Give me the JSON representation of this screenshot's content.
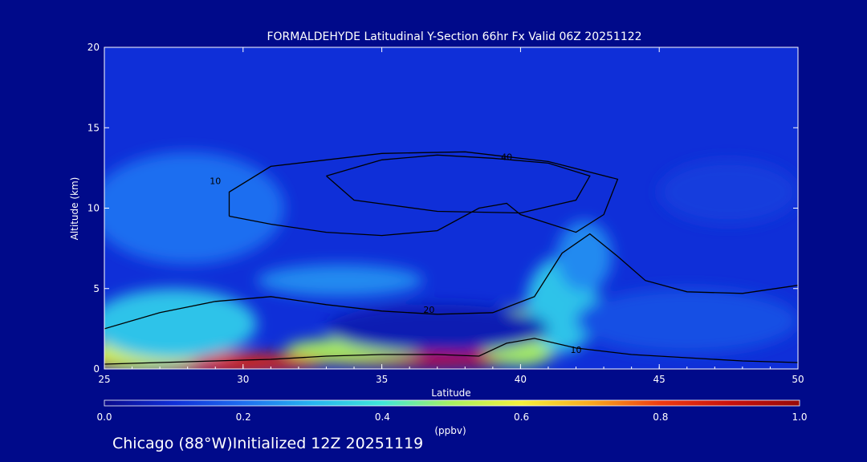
{
  "chart_data": {
    "type": "heatmap",
    "title": "FORMALDEHYDE Latitudinal Y-Section 66hr  Fx Valid 06Z 20251122",
    "xlabel": "Latitude",
    "ylabel": "Altitude (km)",
    "xlim": [
      25,
      50
    ],
    "ylim": [
      0,
      20
    ],
    "x_ticks": [
      "25",
      "30",
      "35",
      "40",
      "45",
      "50"
    ],
    "y_ticks": [
      "0",
      "5",
      "10",
      "15",
      "20"
    ],
    "colorbar": {
      "label": "(ppbv)",
      "range": [
        0.0,
        1.0
      ],
      "ticks": [
        "0.0",
        "0.2",
        "0.4",
        "0.6",
        "0.8",
        "1.0"
      ],
      "colors": [
        "#0a0a8c",
        "#0f2fd8",
        "#1e6ef0",
        "#27b4f0",
        "#40e6d8",
        "#a8f060",
        "#f5f03c",
        "#f8a81e",
        "#ee3a12",
        "#c8100c",
        "#960a08"
      ]
    },
    "field_blobs": [
      {
        "x": 28.5,
        "y": 0.4,
        "rx": 4.5,
        "ry": 0.65,
        "value": 0.85
      },
      {
        "x": 26.5,
        "y": 1.0,
        "rx": 2.0,
        "ry": 1.1,
        "value": 0.55
      },
      {
        "x": 27.5,
        "y": 2.8,
        "rx": 3.0,
        "ry": 2.2,
        "value": 0.33
      },
      {
        "x": 36.5,
        "y": 0.55,
        "rx": 4.0,
        "ry": 0.45,
        "value": 0.92
      },
      {
        "x": 34.0,
        "y": 1.2,
        "rx": 2.5,
        "ry": 0.7,
        "value": 0.5
      },
      {
        "x": 39.3,
        "y": 0.9,
        "rx": 1.0,
        "ry": 0.6,
        "value": 0.88
      },
      {
        "x": 40.0,
        "y": 2.0,
        "rx": 1.6,
        "ry": 1.8,
        "value": 0.5
      },
      {
        "x": 41.5,
        "y": 4.0,
        "rx": 1.3,
        "ry": 3.0,
        "value": 0.33
      },
      {
        "x": 42.3,
        "y": 7.0,
        "rx": 1.0,
        "ry": 2.2,
        "value": 0.24
      },
      {
        "x": 33.5,
        "y": 5.5,
        "rx": 3.0,
        "ry": 1.0,
        "value": 0.24
      },
      {
        "x": 28.0,
        "y": 10.0,
        "rx": 3.5,
        "ry": 3.5,
        "value": 0.2
      },
      {
        "x": 47.5,
        "y": 11.0,
        "rx": 2.5,
        "ry": 2.0,
        "value": 0.12
      },
      {
        "x": 37.0,
        "y": 2.5,
        "rx": 4.0,
        "ry": 1.5,
        "value": 0.05
      },
      {
        "x": 46.0,
        "y": 3.0,
        "rx": 4.0,
        "ry": 2.0,
        "value": 0.15
      }
    ],
    "contours": [
      {
        "label": "10",
        "label_at": [
          42.0,
          1.0
        ],
        "points": [
          [
            25,
            0.3
          ],
          [
            27,
            0.4
          ],
          [
            29,
            0.5
          ],
          [
            31,
            0.6
          ],
          [
            33,
            0.8
          ],
          [
            35,
            0.9
          ],
          [
            37,
            0.9
          ],
          [
            38.5,
            0.8
          ],
          [
            39.5,
            1.6
          ],
          [
            40.5,
            1.9
          ],
          [
            42,
            1.3
          ],
          [
            44,
            0.9
          ],
          [
            46,
            0.7
          ],
          [
            48,
            0.5
          ],
          [
            50,
            0.4
          ]
        ]
      },
      {
        "label": "20",
        "label_at": [
          36.7,
          3.5
        ],
        "points": [
          [
            25,
            2.5
          ],
          [
            27,
            3.5
          ],
          [
            29,
            4.2
          ],
          [
            31,
            4.5
          ],
          [
            33,
            4.0
          ],
          [
            35,
            3.6
          ],
          [
            37,
            3.4
          ],
          [
            39,
            3.5
          ],
          [
            40.5,
            4.5
          ],
          [
            41.5,
            7.2
          ],
          [
            42.5,
            8.4
          ],
          [
            43.5,
            7.0
          ],
          [
            44.5,
            5.5
          ],
          [
            46,
            4.8
          ],
          [
            48,
            4.7
          ],
          [
            50,
            5.2
          ]
        ]
      },
      {
        "label": "40",
        "label_at": [
          39.5,
          13.0
        ],
        "points": [
          [
            33,
            12.0
          ],
          [
            35,
            13.0
          ],
          [
            37,
            13.3
          ],
          [
            39,
            13.1
          ],
          [
            41,
            12.8
          ],
          [
            42.5,
            12.0
          ],
          [
            42,
            10.5
          ],
          [
            40,
            9.7
          ],
          [
            37,
            9.8
          ],
          [
            34,
            10.5
          ],
          [
            33,
            12.0
          ]
        ]
      },
      {
        "label": "10",
        "label_at": [
          29.0,
          11.5
        ],
        "points": [
          [
            29.5,
            9.5
          ],
          [
            31,
            9.0
          ],
          [
            33,
            8.5
          ],
          [
            35,
            8.3
          ],
          [
            37,
            8.6
          ],
          [
            38.5,
            10.0
          ],
          [
            39.5,
            10.3
          ],
          [
            40,
            9.6
          ],
          [
            42,
            8.5
          ],
          [
            43,
            9.6
          ],
          [
            43.5,
            11.8
          ],
          [
            41,
            12.9
          ],
          [
            38,
            13.5
          ],
          [
            35,
            13.4
          ],
          [
            31,
            12.6
          ],
          [
            29.5,
            11.0
          ],
          [
            29.5,
            9.5
          ]
        ]
      }
    ]
  },
  "footer": {
    "text": "Chicago (88°W)Initialized 12Z 20251119"
  }
}
